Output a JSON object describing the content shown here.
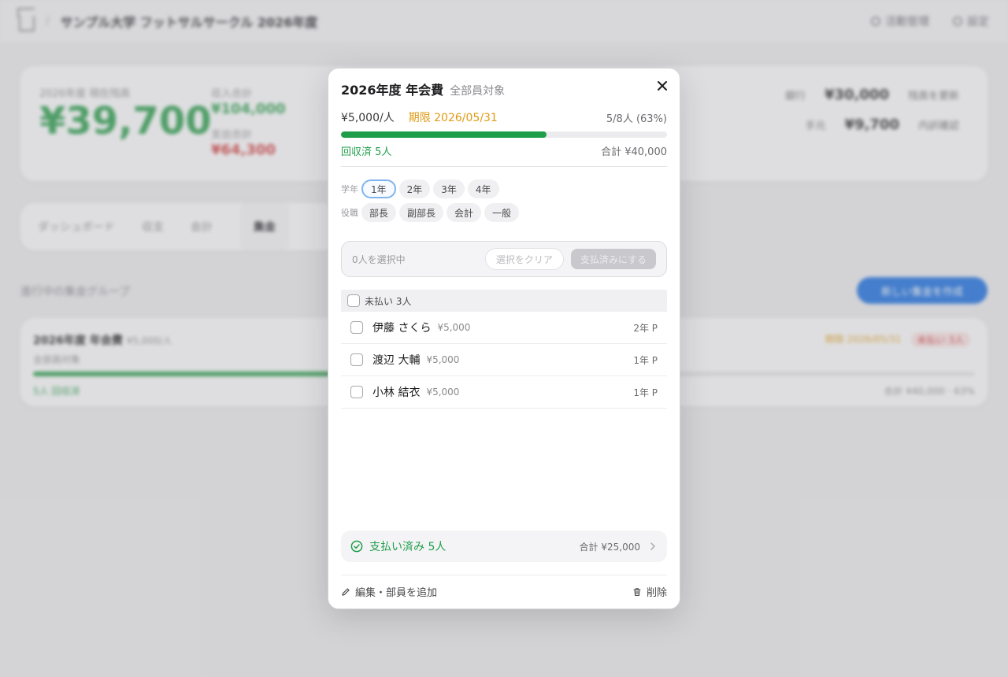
{
  "background": {
    "app_title": "サンプル大学 フットサルサークル 2026年度",
    "nav": [
      "活動管理",
      "設定"
    ],
    "balance": {
      "label": "2026年度 現在残高",
      "amount": "¥39,700",
      "income_label": "収入合計",
      "income": "¥104,000",
      "expense_label": "支出合計",
      "expense": "¥64,300",
      "accounts": [
        {
          "name": "銀行",
          "value": "¥30,000",
          "action": "残高を更新"
        },
        {
          "name": "手元",
          "value": "¥9,700",
          "action": "内訳確認"
        }
      ]
    },
    "tabs": [
      "ダッシュボード",
      "収支",
      "会計",
      "集金"
    ],
    "active_tab": "集金",
    "section_title": "進行中の集金グループ",
    "new_button": "新しい集金を作成",
    "item": {
      "title": "2026年度 年会費",
      "fee": "¥5,000/人",
      "target": "全部員対象",
      "badge_deadline": "期限 2026/05/31",
      "badge_status": "未払い 3人",
      "collected": "5人 回収済",
      "summary": "合計 ¥40,000 · 63%",
      "progress": 0.63
    }
  },
  "modal": {
    "title": "2026年度 年会費",
    "target": "全部員対象",
    "fee": "¥5,000/人",
    "deadline": "期限 2026/05/31",
    "ratio": "5/8人 (63%)",
    "progress": 0.63,
    "collected": "回収済 5人",
    "total": "合計 ¥40,000",
    "filters": {
      "grade_label": "学年",
      "grades": [
        "1年",
        "2年",
        "3年",
        "4年"
      ],
      "selected_grade": "1年",
      "role_label": "役職",
      "roles": [
        "部長",
        "副部長",
        "会計",
        "一般"
      ]
    },
    "selection": {
      "count": "0人を選択中",
      "clear": "選択をクリア",
      "mark_paid": "支払済みにする"
    },
    "unpaid_header": "未払い 3人",
    "unpaid": [
      {
        "name": "伊藤 さくら",
        "amount": "¥5,000",
        "grade": "2年 P"
      },
      {
        "name": "渡辺 大輔",
        "amount": "¥5,000",
        "grade": "1年 P"
      },
      {
        "name": "小林 結衣",
        "amount": "¥5,000",
        "grade": "1年 P"
      }
    ],
    "paid": {
      "label": "支払い済み 5人",
      "total": "合計 ¥25,000"
    },
    "footer": {
      "edit": "編集・部員を追加",
      "delete": "削除"
    },
    "colors": {
      "accent_green": "#1f9e4a",
      "deadline_orange": "#e09a12",
      "chip_selected_border": "#7fb4ee"
    }
  }
}
